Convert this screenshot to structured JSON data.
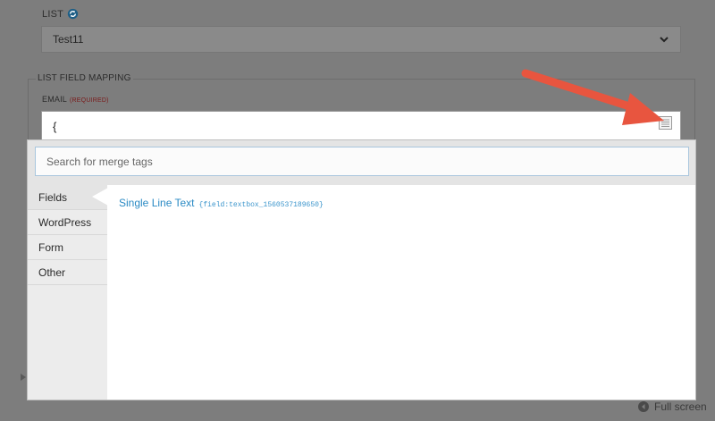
{
  "list": {
    "label": "LIST",
    "selected": "Test11"
  },
  "field_mapping": {
    "legend": "LIST FIELD MAPPING",
    "email_label": "EMAIL",
    "email_required": "(REQUIRED)",
    "email_value": "{"
  },
  "merge_tags": {
    "search_placeholder": "Search for merge tags",
    "categories": [
      {
        "label": "Fields"
      },
      {
        "label": "WordPress"
      },
      {
        "label": "Form"
      },
      {
        "label": "Other"
      }
    ],
    "active_category": "Fields",
    "tags": [
      {
        "label": "Single Line Text",
        "code": "{field:textbox_1560537189650}"
      }
    ]
  },
  "footer": {
    "fullscreen_label": "Full screen"
  },
  "colors": {
    "annotation_arrow": "#e8553f",
    "link": "#2a8ac4"
  }
}
